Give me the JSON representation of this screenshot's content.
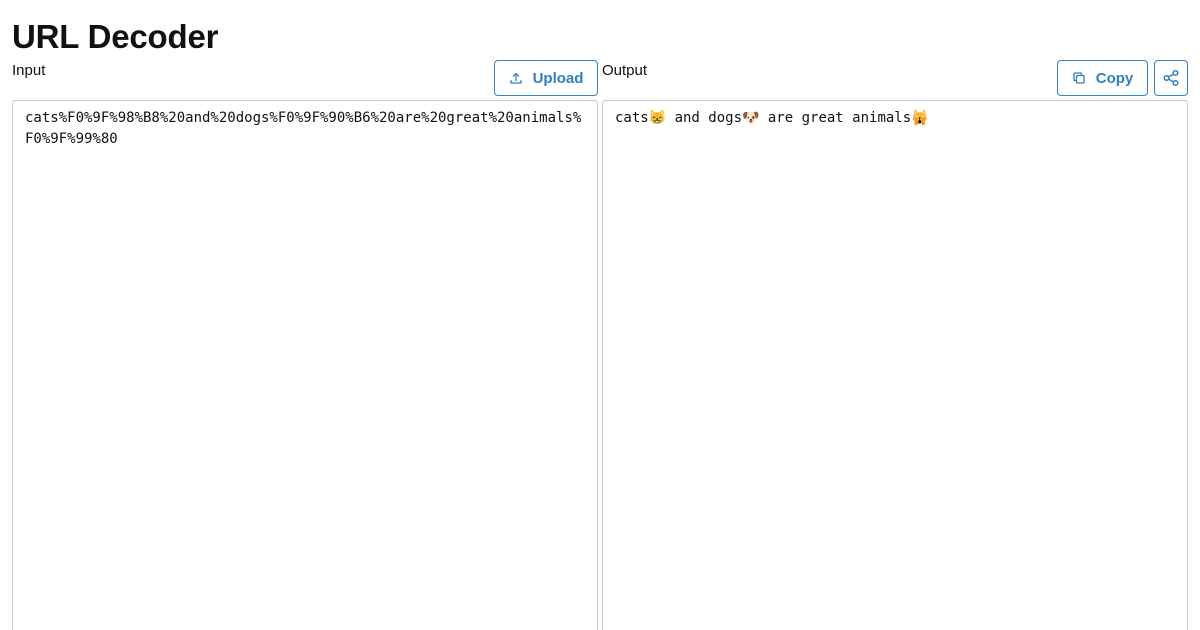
{
  "header": {
    "title": "URL Decoder"
  },
  "input": {
    "label": "Input",
    "upload_label": "Upload",
    "value": "cats%F0%9F%98%B8%20and%20dogs%F0%9F%90%B6%20are%20great%20animals%F0%9F%99%80"
  },
  "output": {
    "label": "Output",
    "copy_label": "Copy",
    "value": "cats😸 and dogs🐶 are great animals🙀"
  },
  "icons": {
    "upload": "upload-icon",
    "copy": "copy-icon",
    "share": "share-icon"
  },
  "colors": {
    "accent": "#2f80c4",
    "border": "#c9c9c9",
    "text": "#111111"
  }
}
